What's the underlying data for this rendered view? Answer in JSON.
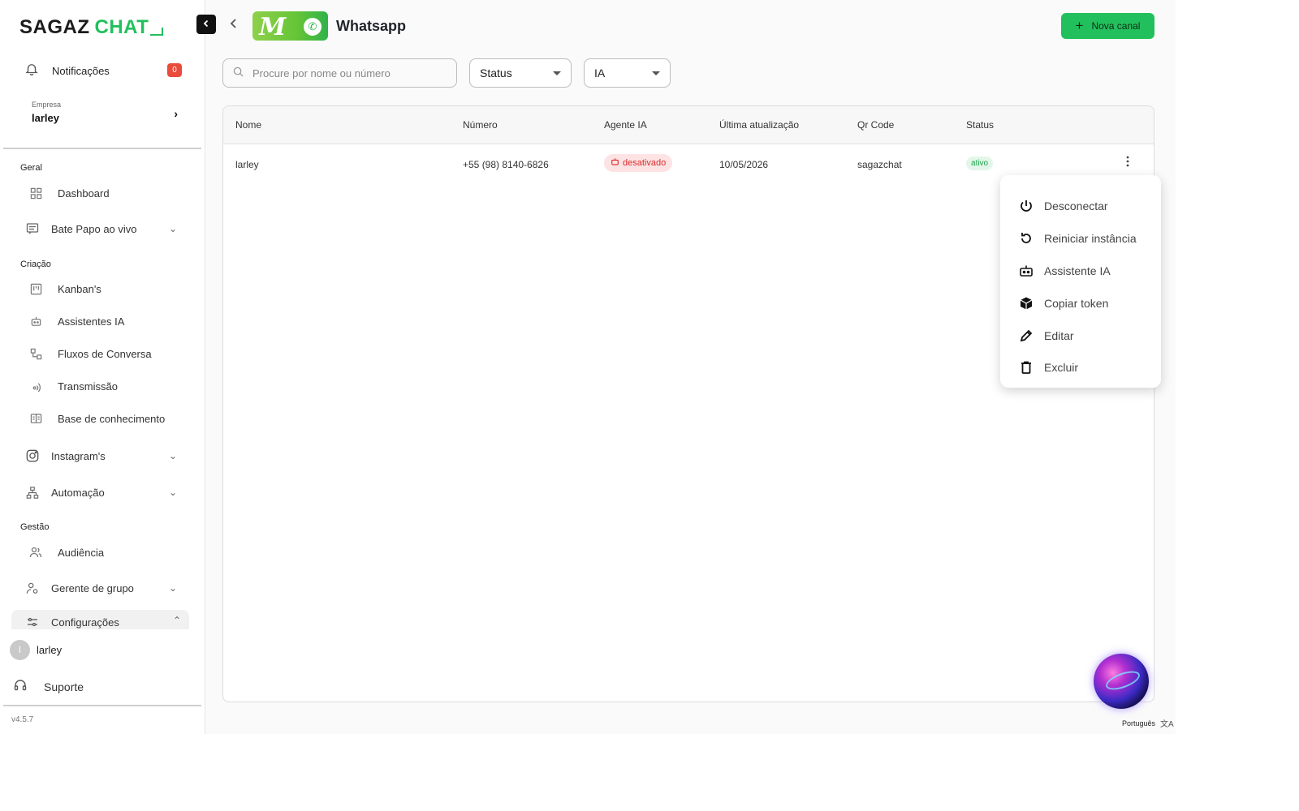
{
  "brand": {
    "part1": "SAGAZ",
    "part2": "CHAT",
    "accent_color": "#22c05c"
  },
  "sidebar": {
    "notifications": {
      "label": "Notificações",
      "count": "0",
      "icon": "bell-icon"
    },
    "company": {
      "label": "Empresa",
      "name": "larley"
    },
    "sections": {
      "geral": "Geral",
      "criacao": "Criação",
      "gestao": "Gestão"
    },
    "items": {
      "dashboard": "Dashboard",
      "bate_papo": "Bate Papo ao vivo",
      "kanban": "Kanban's",
      "assistentes": "Assistentes IA",
      "fluxos": "Fluxos de Conversa",
      "transmissao": "Transmissão",
      "base": "Base de conhecimento",
      "instagram": "Instagram's",
      "automacao": "Automação",
      "audiencia": "Audiência",
      "gerente": "Gerente de grupo",
      "configuracoes": "Configurações"
    },
    "user": {
      "initial": "l",
      "name": "larley"
    },
    "support": "Suporte",
    "version": "v4.5.7"
  },
  "header": {
    "title": "Whatsapp",
    "new_button": "Nova canal"
  },
  "filters": {
    "search_placeholder": "Procure por nome ou número",
    "status": "Status",
    "ia": "IA"
  },
  "table": {
    "columns": [
      "Nome",
      "Número",
      "Agente IA",
      "Última atualização",
      "Qr Code",
      "Status"
    ],
    "rows": [
      {
        "nome": "larley",
        "numero": "+55 (98) 8140-6826",
        "agente": "desativado",
        "atualizacao": "10/05/2026",
        "qrcode": "sagazchat",
        "status": "ativo"
      }
    ]
  },
  "menu": {
    "items": [
      {
        "label": "Desconectar",
        "icon": "power-icon"
      },
      {
        "label": "Reiniciar instância",
        "icon": "restart-icon"
      },
      {
        "label": "Assistente IA",
        "icon": "robot-icon"
      },
      {
        "label": "Copiar token",
        "icon": "cube-icon"
      },
      {
        "label": "Editar",
        "icon": "pencil-icon"
      },
      {
        "label": "Excluir",
        "icon": "trash-icon"
      }
    ]
  },
  "footer": {
    "language": "Português"
  }
}
